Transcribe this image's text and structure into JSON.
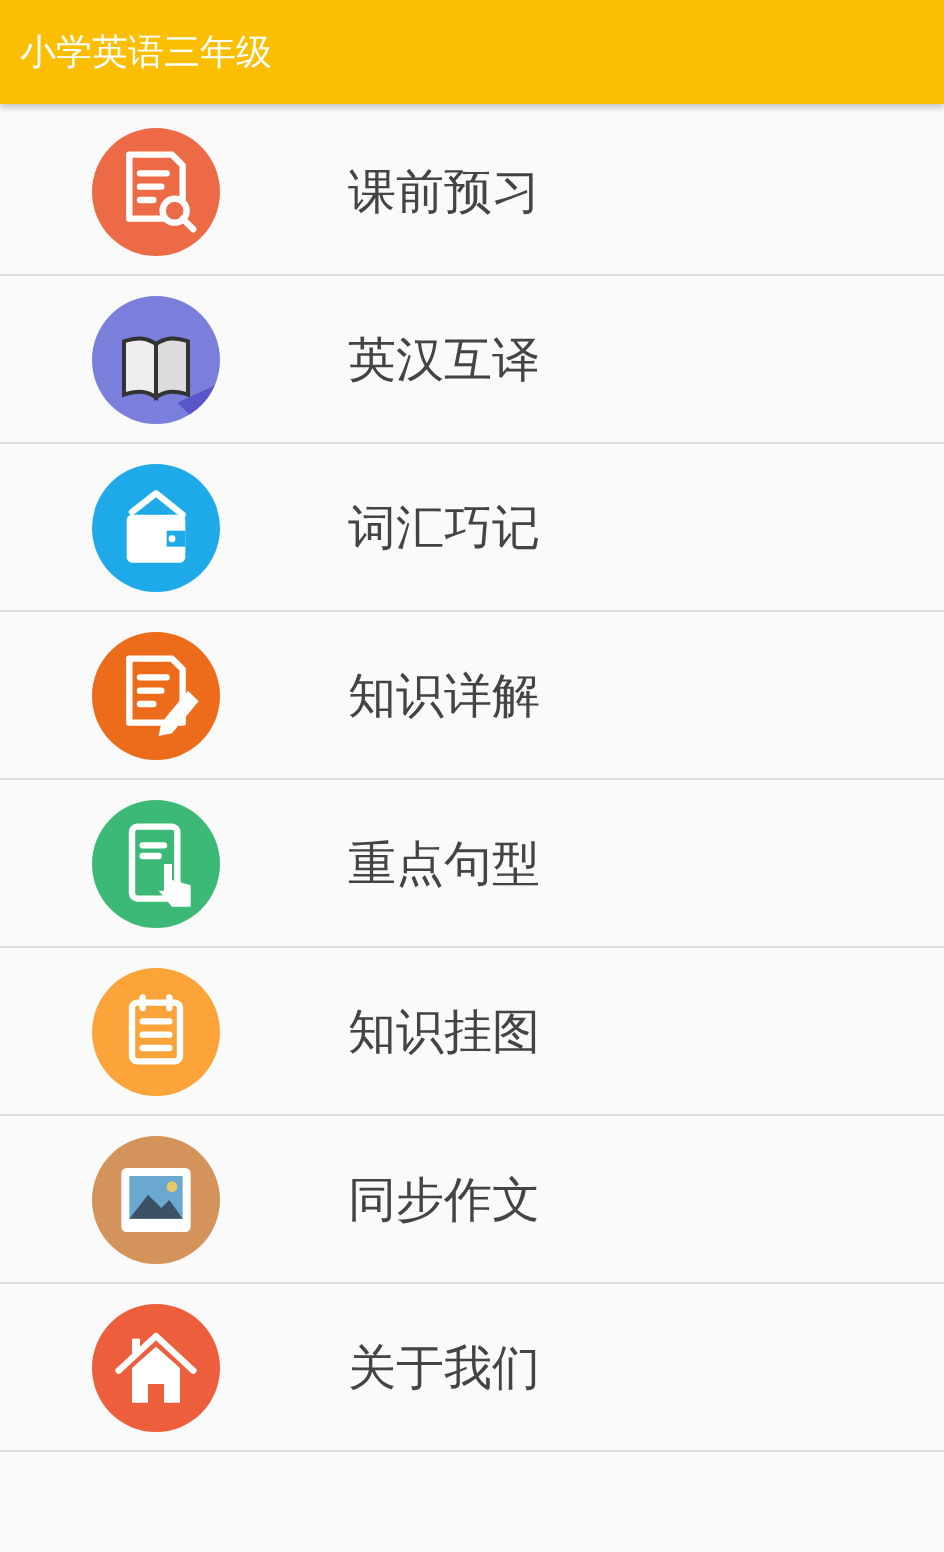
{
  "app_bar": {
    "title": "小学英语三年级"
  },
  "menu": [
    {
      "label": "课前预习",
      "kind": "document-search",
      "color": "#ec6a45"
    },
    {
      "label": "英汉互译",
      "kind": "book",
      "color": "#7b7fdc"
    },
    {
      "label": "词汇巧记",
      "kind": "wallet",
      "color": "#1eaae8"
    },
    {
      "label": "知识详解",
      "kind": "document-pen",
      "color": "#ec6c1c"
    },
    {
      "label": "重点句型",
      "kind": "phone-tap",
      "color": "#3db977"
    },
    {
      "label": "知识挂图",
      "kind": "notepad",
      "color": "#fca33a"
    },
    {
      "label": "同步作文",
      "kind": "image",
      "color": "#d4935a"
    },
    {
      "label": "关于我们",
      "kind": "house",
      "color": "#ec5e3c"
    }
  ]
}
